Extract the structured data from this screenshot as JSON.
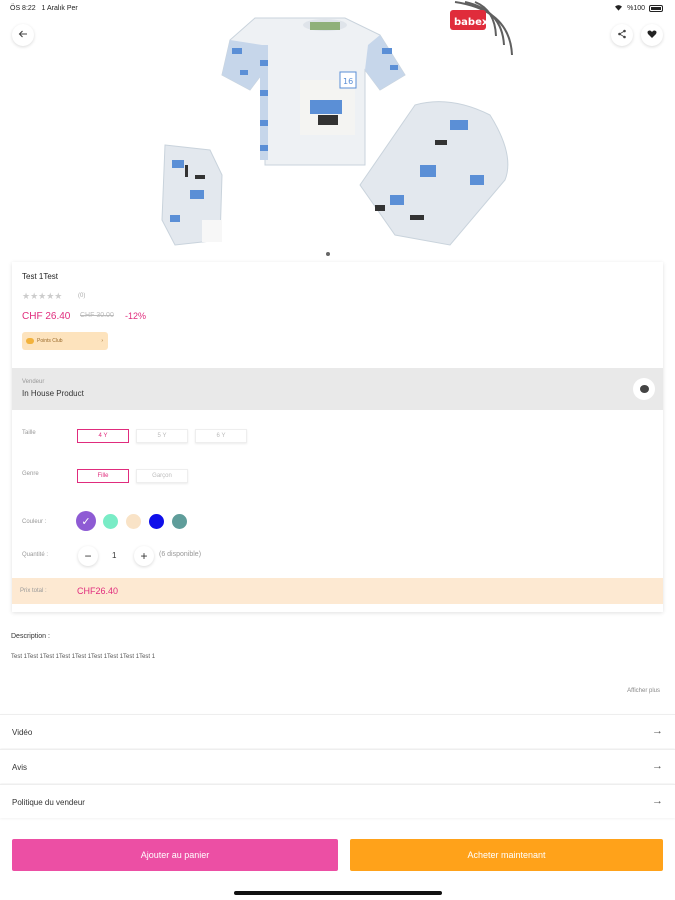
{
  "status_bar": {
    "time": "ÖS 8:22",
    "date": "1 Aralık Per",
    "battery": "%100"
  },
  "header": {
    "back_icon": "arrow-left-icon",
    "share_icon": "share-icon",
    "favorite_icon": "heart-icon"
  },
  "hero": {
    "brand_logo_text": "babexi",
    "pajama_chest_text": "16"
  },
  "product": {
    "title": "Test 1Test",
    "rating_count": "(0)",
    "price": "CHF 26.40",
    "old_price": "CHF 30.00",
    "discount": "-12%",
    "promo_label": "Points Club",
    "promo_chevron": "›"
  },
  "vendor": {
    "label": "Vendeur",
    "name": "In House Product",
    "chat_icon": "chat-icon"
  },
  "options": {
    "size": {
      "label": "Taille",
      "values": [
        "4 Y",
        "5 Y",
        "6 Y"
      ],
      "selected": "4 Y"
    },
    "gender": {
      "label": "Genre",
      "values": [
        "Fille",
        "Garçon"
      ],
      "selected": "Fille"
    },
    "color": {
      "label": "Couleur :",
      "swatches": [
        "#8e5bd4",
        "#79ecc6",
        "#f9e3c7",
        "#0f0fea",
        "#5f9d9a"
      ],
      "selected_index": 0,
      "check": "✓"
    }
  },
  "quantity": {
    "label": "Quantité :",
    "value": "1",
    "minus": "−",
    "plus": "+",
    "available": "(6 disponible)"
  },
  "total": {
    "label": "Prix total :",
    "value": "CHF26.40"
  },
  "description": {
    "label": "Description :",
    "text": "Test 1Test 1Test 1Test 1Test 1Test 1Test 1Test 1Test 1",
    "show_more": "Afficher plus"
  },
  "links": [
    {
      "label": "Vidéo",
      "arrow": "→"
    },
    {
      "label": "Avis",
      "arrow": "→"
    },
    {
      "label": "Politique du vendeur",
      "arrow": "→"
    }
  ],
  "actions": {
    "add_to_cart": "Ajouter au panier",
    "buy_now": "Acheter maintenant"
  },
  "colors": {
    "accent_pink": "#e02c7d",
    "cart_button": "#ec4fa4",
    "buy_button": "#ffa21a"
  }
}
